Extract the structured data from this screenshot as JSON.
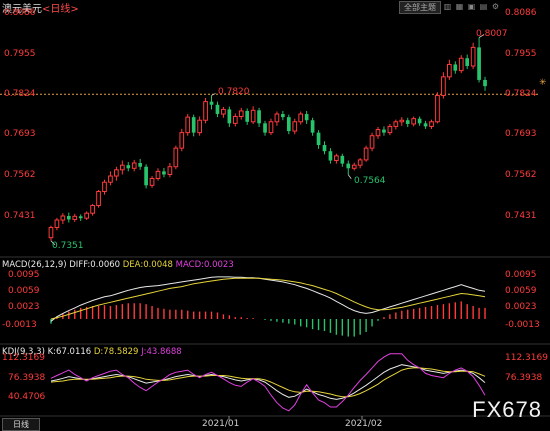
{
  "header": {
    "symbol": "澳元美元",
    "period": "<日线>",
    "right_button": "全部主题"
  },
  "price_axis": {
    "ticks": [
      "0.8086",
      "0.7955",
      "0.7824",
      "0.7693",
      "0.7562",
      "0.7431"
    ]
  },
  "annotations": {
    "high": "0.8007",
    "mid_high": "0.7820",
    "mid_low": "0.7564",
    "low": "0.7351"
  },
  "macd": {
    "label": "MACD(26,12,9)",
    "diff": "DIFF:0.0060",
    "dea": "DEA:0.0048",
    "macd": "MACD:0.0023",
    "ticks": [
      "0.0095",
      "0.0059",
      "0.0023",
      "-0.0013"
    ]
  },
  "kdj": {
    "label": "KDJ(9,3,3)",
    "k": "K:67.0116",
    "d": "D:78.5829",
    "j": "J:43.8688",
    "ticks": [
      "112.3169",
      "76.3938",
      "40.4706"
    ]
  },
  "dates": [
    "2021/01",
    "2021/02"
  ],
  "bottom_tab": "日线",
  "watermark": "FX678",
  "colors": {
    "up": "#ff3b3b",
    "down": "#27c46b",
    "dea": "#e6d43a",
    "j": "#e040e0",
    "dashed": "#e6a23c"
  },
  "chart_data": {
    "type": "candlestick",
    "title": "澳元美元 <日线>",
    "ylim": [
      0.7351,
      0.8086
    ],
    "candles": [
      [
        0.7361,
        0.7394,
        0.7351,
        0.74
      ],
      [
        0.7394,
        0.7418,
        0.7385,
        0.7425
      ],
      [
        0.7418,
        0.7431,
        0.7405,
        0.744
      ],
      [
        0.7431,
        0.742,
        0.741,
        0.7442
      ],
      [
        0.742,
        0.743,
        0.7412,
        0.7438
      ],
      [
        0.743,
        0.7424,
        0.7415,
        0.7436
      ],
      [
        0.7424,
        0.744,
        0.7418,
        0.7446
      ],
      [
        0.744,
        0.7465,
        0.7432,
        0.747
      ],
      [
        0.7465,
        0.751,
        0.7458,
        0.7515
      ],
      [
        0.751,
        0.754,
        0.75,
        0.7548
      ],
      [
        0.754,
        0.756,
        0.753,
        0.7575
      ],
      [
        0.756,
        0.758,
        0.7545,
        0.759
      ],
      [
        0.758,
        0.7595,
        0.7565,
        0.761
      ],
      [
        0.7595,
        0.7585,
        0.7575,
        0.7605
      ],
      [
        0.7585,
        0.7602,
        0.7575,
        0.7612
      ],
      [
        0.7602,
        0.759,
        0.758,
        0.7615
      ],
      [
        0.759,
        0.753,
        0.752,
        0.7598
      ],
      [
        0.753,
        0.7552,
        0.7522,
        0.756
      ],
      [
        0.7552,
        0.7575,
        0.7545,
        0.7585
      ],
      [
        0.7575,
        0.7565,
        0.7556,
        0.7586
      ],
      [
        0.7565,
        0.759,
        0.7556,
        0.7602
      ],
      [
        0.759,
        0.765,
        0.7582,
        0.7658
      ],
      [
        0.765,
        0.77,
        0.764,
        0.7712
      ],
      [
        0.77,
        0.775,
        0.769,
        0.776
      ],
      [
        0.775,
        0.77,
        0.7688,
        0.7758
      ],
      [
        0.77,
        0.774,
        0.769,
        0.7752
      ],
      [
        0.774,
        0.78,
        0.773,
        0.7812
      ],
      [
        0.78,
        0.779,
        0.7775,
        0.782
      ],
      [
        0.779,
        0.776,
        0.775,
        0.78
      ],
      [
        0.776,
        0.7775,
        0.7748,
        0.7783
      ],
      [
        0.7775,
        0.773,
        0.7718,
        0.7784
      ],
      [
        0.773,
        0.7752,
        0.772,
        0.7762
      ],
      [
        0.7752,
        0.777,
        0.7742,
        0.778
      ],
      [
        0.777,
        0.7735,
        0.7725,
        0.7778
      ],
      [
        0.7735,
        0.7772,
        0.7728,
        0.7785
      ],
      [
        0.7772,
        0.773,
        0.7718,
        0.778
      ],
      [
        0.773,
        0.77,
        0.769,
        0.7738
      ],
      [
        0.77,
        0.7735,
        0.7692,
        0.7745
      ],
      [
        0.7735,
        0.776,
        0.7722,
        0.7768
      ],
      [
        0.776,
        0.775,
        0.774,
        0.777
      ],
      [
        0.775,
        0.7705,
        0.7695,
        0.7758
      ],
      [
        0.7705,
        0.7735,
        0.7695,
        0.7745
      ],
      [
        0.7735,
        0.776,
        0.7726,
        0.7768
      ],
      [
        0.776,
        0.774,
        0.7728,
        0.777
      ],
      [
        0.774,
        0.77,
        0.769,
        0.7748
      ],
      [
        0.77,
        0.766,
        0.7648,
        0.7708
      ],
      [
        0.766,
        0.764,
        0.763,
        0.7672
      ],
      [
        0.764,
        0.761,
        0.76,
        0.765
      ],
      [
        0.761,
        0.7625,
        0.76,
        0.7632
      ],
      [
        0.7625,
        0.76,
        0.759,
        0.7632
      ],
      [
        0.76,
        0.7585,
        0.7564,
        0.761
      ],
      [
        0.7585,
        0.7595,
        0.7578,
        0.7603
      ],
      [
        0.7595,
        0.7612,
        0.7585,
        0.7618
      ],
      [
        0.7612,
        0.765,
        0.7606,
        0.7658
      ],
      [
        0.765,
        0.769,
        0.764,
        0.77
      ],
      [
        0.769,
        0.771,
        0.768,
        0.7718
      ],
      [
        0.771,
        0.77,
        0.769,
        0.772
      ],
      [
        0.77,
        0.772,
        0.7692,
        0.7728
      ],
      [
        0.772,
        0.7735,
        0.771,
        0.7742
      ],
      [
        0.7735,
        0.774,
        0.7722,
        0.775
      ],
      [
        0.774,
        0.7728,
        0.7718,
        0.7748
      ],
      [
        0.7728,
        0.7745,
        0.772,
        0.7752
      ],
      [
        0.7745,
        0.773,
        0.7722,
        0.7752
      ],
      [
        0.773,
        0.772,
        0.7712,
        0.7738
      ],
      [
        0.772,
        0.7735,
        0.7712,
        0.7742
      ],
      [
        0.7735,
        0.782,
        0.773,
        0.783
      ],
      [
        0.782,
        0.788,
        0.781,
        0.7895
      ],
      [
        0.788,
        0.792,
        0.787,
        0.7935
      ],
      [
        0.792,
        0.79,
        0.789,
        0.793
      ],
      [
        0.79,
        0.794,
        0.7892,
        0.795
      ],
      [
        0.794,
        0.7915,
        0.7905,
        0.7952
      ],
      [
        0.7915,
        0.7975,
        0.7905,
        0.799
      ],
      [
        0.7975,
        0.787,
        0.7862,
        0.8007
      ],
      [
        0.787,
        0.785,
        0.7835,
        0.788
      ]
    ],
    "dashed_level": 0.7824,
    "macd_diff": [
      -0.0005,
      0.0005,
      0.0012,
      0.0018,
      0.0024,
      0.003,
      0.0035,
      0.004,
      0.0044,
      0.0048,
      0.005,
      0.0054,
      0.0058,
      0.0062,
      0.0065,
      0.0068,
      0.007,
      0.0071,
      0.0072,
      0.0074,
      0.0076,
      0.0078,
      0.008,
      0.0082,
      0.0084,
      0.0086,
      0.0088,
      0.009,
      0.0091,
      0.0091,
      0.0091,
      0.009,
      0.009,
      0.0089,
      0.0089,
      0.0088,
      0.0086,
      0.0084,
      0.0082,
      0.008,
      0.0077,
      0.0074,
      0.007,
      0.0066,
      0.0061,
      0.0056,
      0.0051,
      0.0045,
      0.0038,
      0.0031,
      0.0024,
      0.0018,
      0.0014,
      0.0012,
      0.0014,
      0.0018,
      0.0022,
      0.0026,
      0.003,
      0.0034,
      0.0038,
      0.0042,
      0.0046,
      0.005,
      0.0054,
      0.0058,
      0.0062,
      0.0066,
      0.007,
      0.0074,
      0.007,
      0.0066,
      0.0062,
      0.006
    ],
    "macd_dea": [
      0.0,
      0.0003,
      0.0006,
      0.001,
      0.0014,
      0.0018,
      0.0022,
      0.0026,
      0.003,
      0.0033,
      0.0036,
      0.0039,
      0.0042,
      0.0045,
      0.0048,
      0.0051,
      0.0054,
      0.0057,
      0.006,
      0.0063,
      0.0066,
      0.0068,
      0.007,
      0.0073,
      0.0076,
      0.0078,
      0.008,
      0.0082,
      0.0084,
      0.0086,
      0.0087,
      0.0088,
      0.0088,
      0.0088,
      0.0088,
      0.0088,
      0.0087,
      0.0086,
      0.0085,
      0.0084,
      0.0082,
      0.008,
      0.0078,
      0.0075,
      0.0072,
      0.0068,
      0.0064,
      0.006,
      0.0055,
      0.0049,
      0.0043,
      0.0037,
      0.0031,
      0.0026,
      0.0022,
      0.002,
      0.002,
      0.0021,
      0.0023,
      0.0025,
      0.0028,
      0.0031,
      0.0034,
      0.0037,
      0.004,
      0.0043,
      0.0046,
      0.0049,
      0.0052,
      0.0055,
      0.0054,
      0.0052,
      0.005,
      0.0048
    ],
    "kdj_k": [
      70,
      72,
      75,
      78,
      76,
      74,
      72,
      74,
      76,
      78,
      80,
      82,
      80,
      78,
      74,
      70,
      66,
      68,
      70,
      72,
      75,
      78,
      80,
      82,
      80,
      78,
      80,
      82,
      80,
      78,
      75,
      72,
      70,
      72,
      74,
      72,
      68,
      60,
      52,
      45,
      40,
      42,
      48,
      55,
      50,
      45,
      42,
      38,
      36,
      38,
      42,
      48,
      55,
      62,
      70,
      78,
      86,
      92,
      96,
      100,
      98,
      96,
      94,
      90,
      88,
      86,
      84,
      86,
      88,
      90,
      88,
      84,
      76,
      67
    ],
    "kdj_d": [
      68,
      69,
      70,
      72,
      73,
      73,
      73,
      73,
      74,
      75,
      76,
      78,
      79,
      79,
      78,
      76,
      73,
      72,
      71,
      71,
      72,
      74,
      76,
      78,
      79,
      79,
      79,
      80,
      80,
      80,
      79,
      77,
      75,
      74,
      74,
      74,
      72,
      68,
      63,
      58,
      53,
      50,
      49,
      51,
      51,
      50,
      48,
      46,
      43,
      41,
      41,
      43,
      47,
      52,
      58,
      64,
      72,
      78,
      84,
      90,
      93,
      94,
      94,
      93,
      92,
      90,
      88,
      87,
      87,
      88,
      88,
      87,
      83,
      78.58
    ],
    "kdj_j": [
      75,
      80,
      85,
      90,
      82,
      76,
      70,
      76,
      80,
      84,
      88,
      90,
      82,
      76,
      66,
      58,
      52,
      60,
      68,
      74,
      82,
      86,
      88,
      90,
      82,
      76,
      82,
      86,
      80,
      74,
      67,
      62,
      60,
      68,
      74,
      68,
      60,
      44,
      30,
      20,
      15,
      26,
      46,
      63,
      48,
      35,
      30,
      22,
      22,
      32,
      44,
      58,
      71,
      82,
      94,
      106,
      114,
      120,
      120,
      120,
      108,
      100,
      94,
      84,
      80,
      78,
      76,
      84,
      90,
      94,
      88,
      78,
      62,
      43.87
    ]
  }
}
